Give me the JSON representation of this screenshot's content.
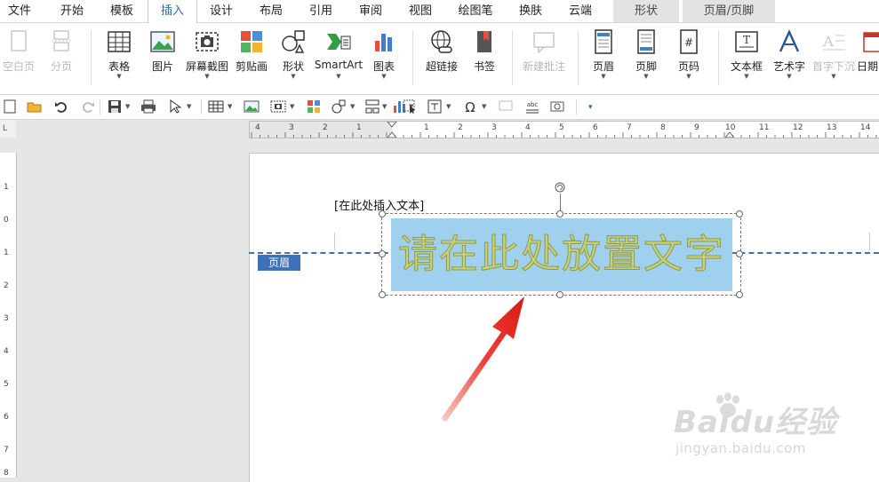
{
  "menu": {
    "items": [
      "文件",
      "开始",
      "模板",
      "插入",
      "设计",
      "布局",
      "引用",
      "审阅",
      "视图",
      "绘图笔",
      "换肤",
      "云端"
    ],
    "active_index": 3,
    "context_tabs": [
      "形状",
      "页眉/页脚"
    ]
  },
  "ribbon": {
    "blank_page": "空白页",
    "page_break": "分页",
    "table": "表格",
    "picture": "图片",
    "screenshot": "屏幕截图",
    "clip_art": "剪贴画",
    "shapes": "形状",
    "smartart": "SmartArt",
    "chart": "图表",
    "hyperlink": "超链接",
    "bookmark": "书签",
    "new_comment": "新建批注",
    "header": "页眉",
    "footer": "页脚",
    "page_number": "页码",
    "textbox": "文本框",
    "wordart": "艺术字",
    "drop_cap": "首字下沉",
    "date": "日期"
  },
  "corner_label": "L",
  "hruler": {
    "left_numbers": [
      "4",
      "3",
      "2",
      "1"
    ],
    "right_numbers": [
      "1",
      "2",
      "3",
      "4",
      "5",
      "6",
      "7",
      "8",
      "9",
      "10",
      "11",
      "12",
      "13",
      "14"
    ]
  },
  "vruler": {
    "numbers": [
      "1",
      "0",
      "1",
      "2",
      "3",
      "4",
      "5",
      "6",
      "7",
      "8"
    ]
  },
  "document": {
    "header_placeholder": "[在此处插入文本]",
    "header_badge": "页眉",
    "wordart_text": "请在此处放置文字"
  },
  "colors": {
    "accent": "#2a6ebb",
    "header_line": "#3d6fb6",
    "wordart_fill": "#c7d07a",
    "wordart_box": "#9fd0ee",
    "arrow": "#e8231b"
  },
  "watermark": {
    "brand": "Baidu经验",
    "url": "jingyan.baidu.com"
  }
}
